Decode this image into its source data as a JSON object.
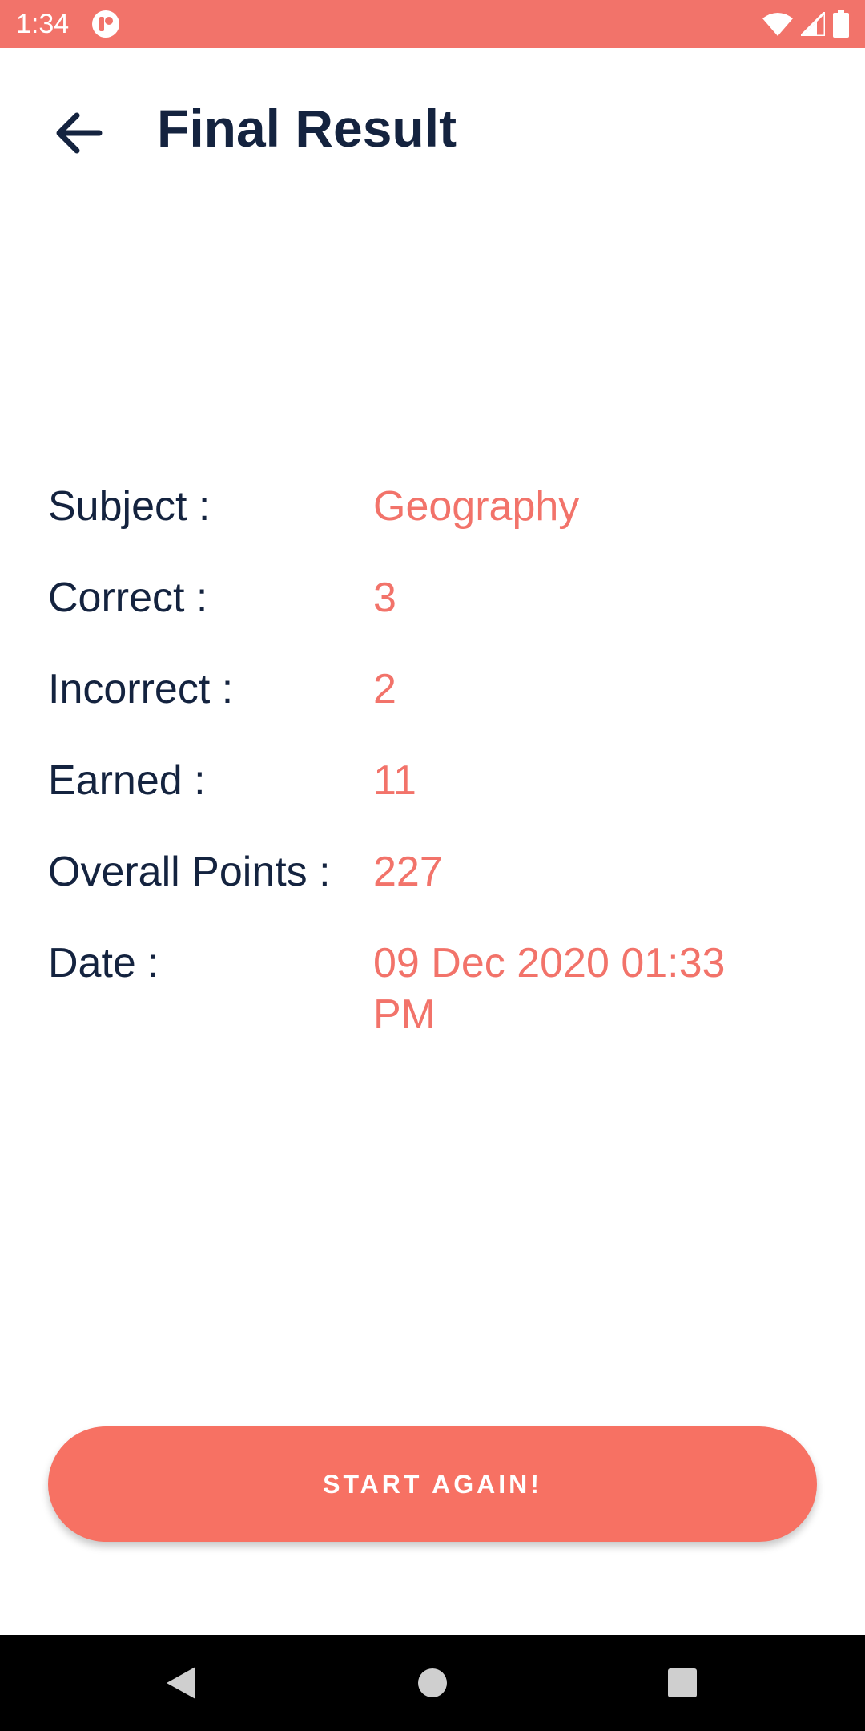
{
  "status_bar": {
    "time": "1:34",
    "icons": [
      "app-notification-icon",
      "wifi-icon",
      "signal-icon",
      "battery-icon"
    ]
  },
  "header": {
    "title": "Final Result",
    "back_icon": "arrow-left-icon"
  },
  "results": [
    {
      "label": "Subject :",
      "value": "Geography"
    },
    {
      "label": "Correct :",
      "value": "3"
    },
    {
      "label": "Incorrect :",
      "value": "2"
    },
    {
      "label": "Earned :",
      "value": "11"
    },
    {
      "label": "Overall Points :",
      "value": "227"
    },
    {
      "label": "Date :",
      "value": "09 Dec 2020 01:33 PM"
    }
  ],
  "actions": {
    "start_again_label": "START AGAIN!"
  },
  "nav_bar": {
    "buttons": [
      "back-triangle-icon",
      "home-circle-icon",
      "recents-square-icon"
    ]
  },
  "colors": {
    "accent": "#f2736a",
    "button": "#f77163",
    "text_dark": "#14233f",
    "nav_bar": "#000000"
  }
}
